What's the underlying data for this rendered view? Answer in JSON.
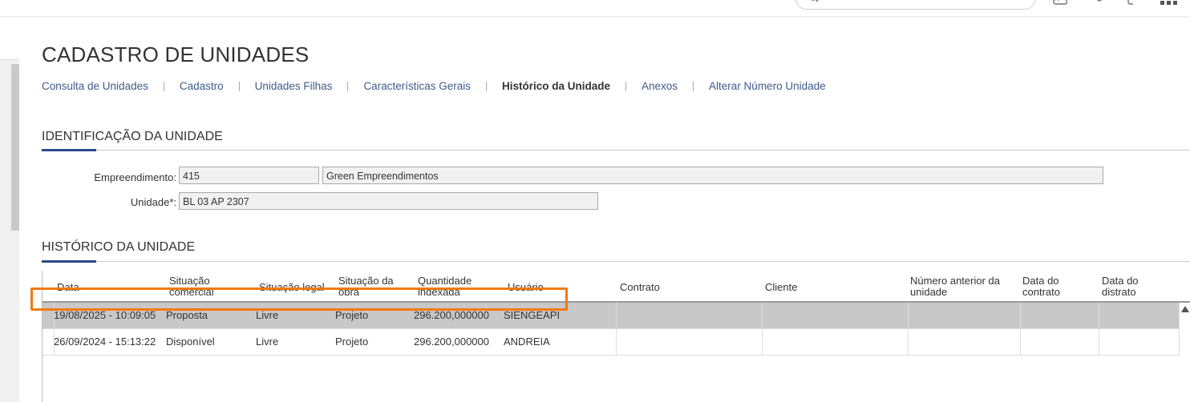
{
  "page": {
    "title": "CADASTRO DE UNIDADES"
  },
  "tabs": [
    {
      "label": "Consulta de Unidades"
    },
    {
      "label": "Cadastro"
    },
    {
      "label": "Unidades Filhas"
    },
    {
      "label": "Características Gerais"
    },
    {
      "label": "Histórico da Unidade",
      "active": true
    },
    {
      "label": "Anexos"
    },
    {
      "label": "Alterar Número Unidade"
    }
  ],
  "identificacao": {
    "title": "IDENTIFICAÇÃO DA UNIDADE",
    "empreendimento_label": "Empreendimento:",
    "empreendimento_code": "415",
    "empreendimento_name": "Green Empreendimentos",
    "unidade_label": "Unidade*:",
    "unidade_value": "BL 03 AP  2307"
  },
  "historico": {
    "title": "HISTÓRICO DA UNIDADE",
    "columns": {
      "data": "Data",
      "situacao_comercial": "Situação comercial",
      "situacao_legal": "Situação legal",
      "situacao_obra": "Situação da obra",
      "quantidade": "Quantidade indexada",
      "usuario": "Usuário",
      "contrato": "Contrato",
      "cliente": "Cliente",
      "numero_anterior": "Número anterior da unidade",
      "data_contrato": "Data do contrato",
      "data_distrato": "Data do distrato"
    },
    "rows": [
      {
        "data": "19/08/2025 -  10:09:05",
        "situacao_comercial": "Proposta",
        "situacao_legal": "Livre",
        "situacao_obra": "Projeto",
        "quantidade": "296.200,000000",
        "usuario": "SIENGEAPI",
        "contrato": "",
        "cliente": "",
        "numero_anterior": "",
        "data_contrato": "",
        "data_distrato": ""
      },
      {
        "data": "26/09/2024 -  15:13:22",
        "situacao_comercial": "Disponível",
        "situacao_legal": "Livre",
        "situacao_obra": "Projeto",
        "quantidade": "296.200,000000",
        "usuario": "ANDREIA",
        "contrato": "",
        "cliente": "",
        "numero_anterior": "",
        "data_contrato": "",
        "data_distrato": ""
      }
    ]
  },
  "colors": {
    "accent": "#2b4a8a",
    "highlight": "#f07a10",
    "selected_row": "#c8c8c8",
    "link": "#3d5b8a"
  },
  "icons": [
    "search-icon",
    "cloud-icon",
    "help-icon",
    "notification-icon",
    "apps-grid-icon"
  ]
}
